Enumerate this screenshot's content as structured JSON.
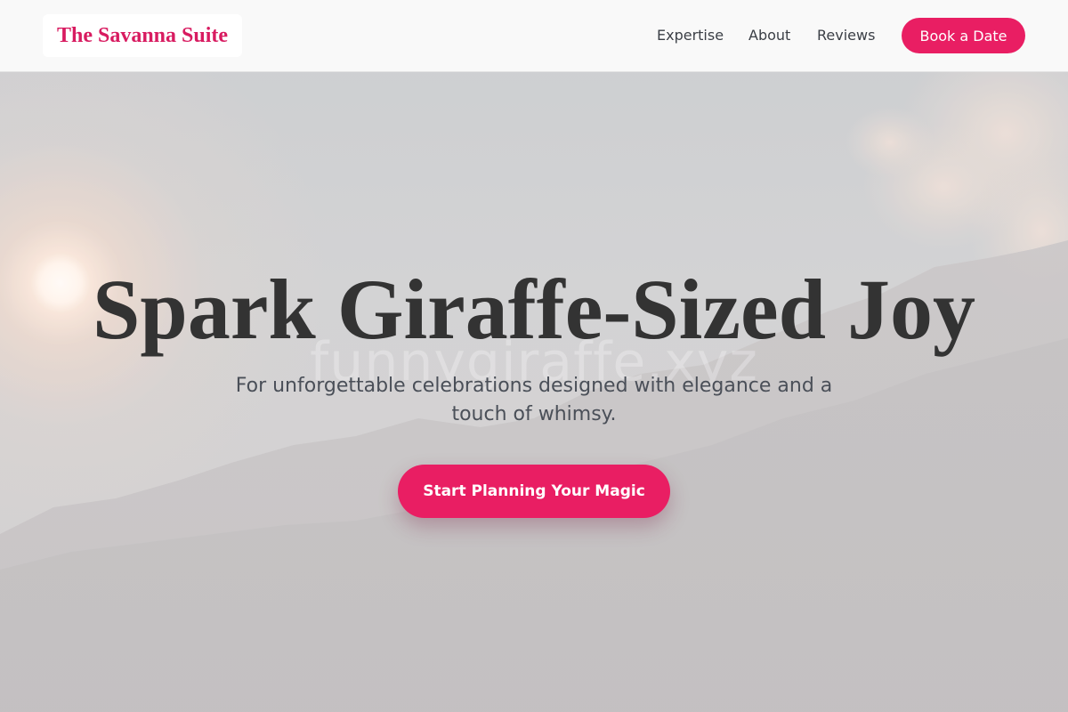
{
  "brand": {
    "name": "The Savanna Suite"
  },
  "nav": {
    "links": [
      {
        "label": "Expertise"
      },
      {
        "label": "About"
      },
      {
        "label": "Reviews"
      }
    ],
    "cta_label": "Book a Date"
  },
  "hero": {
    "headline": "Spark Giraffe-Sized Joy",
    "watermark": "funnygiraffe.xyz",
    "subtitle": "For unforgettable celebrations designed with elegance and a touch of whimsy.",
    "cta_label": "Start Planning Your Magic",
    "background": "hazy-sunset-mountains-image"
  },
  "colors": {
    "accent": "#e91e63",
    "brand_text": "#d81b60",
    "headline": "#333333",
    "subtitle": "#4a4f58",
    "nav_bg": "#f9f9f9"
  }
}
